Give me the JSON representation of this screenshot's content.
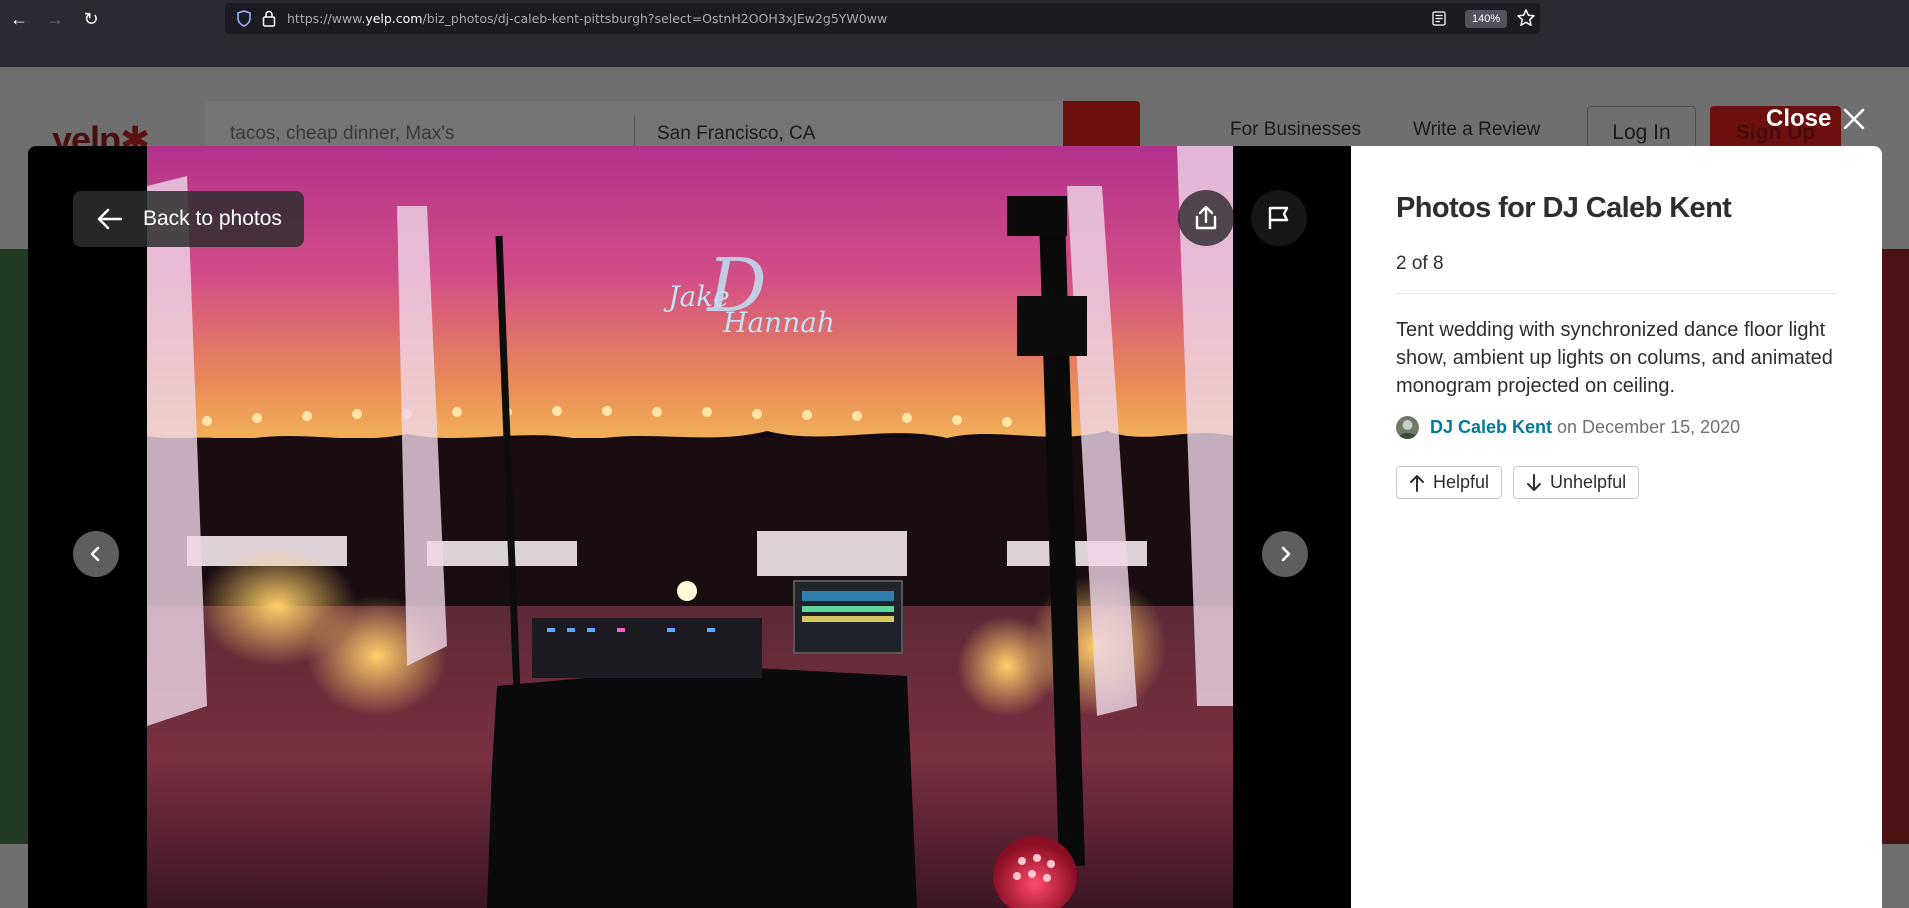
{
  "browser": {
    "url_prefix": "https://www.",
    "url_domain": "yelp.com",
    "url_path": "/biz_photos/dj-caleb-kent-pittsburgh?select=OstnH2OOH3xJEw2g5YW0ww",
    "zoom": "140%"
  },
  "background_page": {
    "logo": "yelp",
    "search_placeholder": "tacos, cheap dinner, Max's",
    "location": "San Francisco, CA",
    "for_businesses": "For Businesses",
    "write_review": "Write a Review",
    "log_in": "Log In",
    "sign_up": "Sign Up"
  },
  "modal": {
    "close_label": "Close",
    "back_label": "Back to photos",
    "photo_projection": {
      "name_top": "Jake",
      "initial": "D",
      "name_bottom": "Hannah"
    },
    "title": "Photos for DJ Caleb Kent",
    "counter": "2 of 8",
    "caption": "Tent wedding with synchronized dance floor light show, ambient up lights on colums, and animated monogram projected on ceiling.",
    "author": "DJ Caleb Kent",
    "date_text": "on December 15, 2020",
    "helpful_label": "Helpful",
    "unhelpful_label": "Unhelpful"
  },
  "icons": {
    "back": "arrow-left-icon",
    "share": "share-icon",
    "report": "flag-icon",
    "prev": "chevron-left-icon",
    "next": "chevron-right-icon",
    "close": "close-icon"
  },
  "colors": {
    "brand_red": "#d32323",
    "link_teal": "#027a97",
    "browser_chrome": "#2b2a33"
  }
}
